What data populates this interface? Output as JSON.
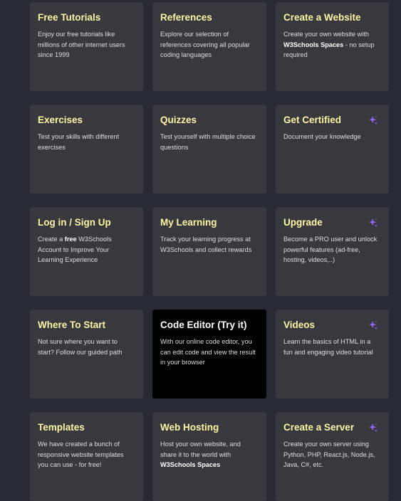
{
  "colors": {
    "background": "#282A35",
    "card": "#38393F",
    "card_dark": "#000000",
    "title": "#FFF4A3",
    "text": "#DDDDE3",
    "sparkle": "#9763F6"
  },
  "cards": [
    {
      "title": "Free Tutorials",
      "desc": "Enjoy our free tutorials like millions of other internet users since 1999",
      "icon": null
    },
    {
      "title": "References",
      "desc": "Explore our selection of references covering all popular coding languages",
      "icon": null
    },
    {
      "title": "Create a Website",
      "desc_pre": "Create your own website with ",
      "desc_bold": "W3Schools Spaces",
      "desc_post": " - no setup required",
      "icon": null
    },
    {
      "title": "Exercises",
      "desc": "Test your skills with different exercises",
      "icon": null
    },
    {
      "title": "Quizzes",
      "desc": "Test yourself with multiple choice questions",
      "icon": null
    },
    {
      "title": "Get Certified",
      "desc": "Document your knowledge",
      "icon": "sparkle-icon"
    },
    {
      "title": "Log in / Sign Up",
      "desc_pre": "Create a ",
      "desc_bold": "free",
      "desc_post": " W3Schools Account to Improve Your Learning Experience",
      "icon": null
    },
    {
      "title": "My Learning",
      "desc": "Track your learning progress at W3Schools and collect rewards",
      "icon": null
    },
    {
      "title": "Upgrade",
      "desc": "Become a PRO user and unlock powerful features (ad-free, hosting, videos,..)",
      "icon": "sparkle-icon"
    },
    {
      "title": "Where To Start",
      "desc": "Not sure where you want to start? Follow our guided path",
      "icon": null
    },
    {
      "title": "Code Editor (Try it)",
      "desc": "With our online code editor, you can edit code and view the result in your browser",
      "icon": null
    },
    {
      "title": "Videos",
      "desc": "Learn the basics of HTML in a fun and engaging video tutorial",
      "icon": "sparkle-icon"
    },
    {
      "title": "Templates",
      "desc": "We have created a bunch of responsive website templates you can use - for free!",
      "icon": null
    },
    {
      "title": "Web Hosting",
      "desc_pre": "Host your own website, and share it to the world with ",
      "desc_bold": "W3Schools Spaces",
      "desc_post": "",
      "icon": null
    },
    {
      "title": "Create a Server",
      "desc": "Create your own server using Python, PHP, React.js, Node.js, Java, C#, etc.",
      "icon": "sparkle-icon"
    }
  ]
}
